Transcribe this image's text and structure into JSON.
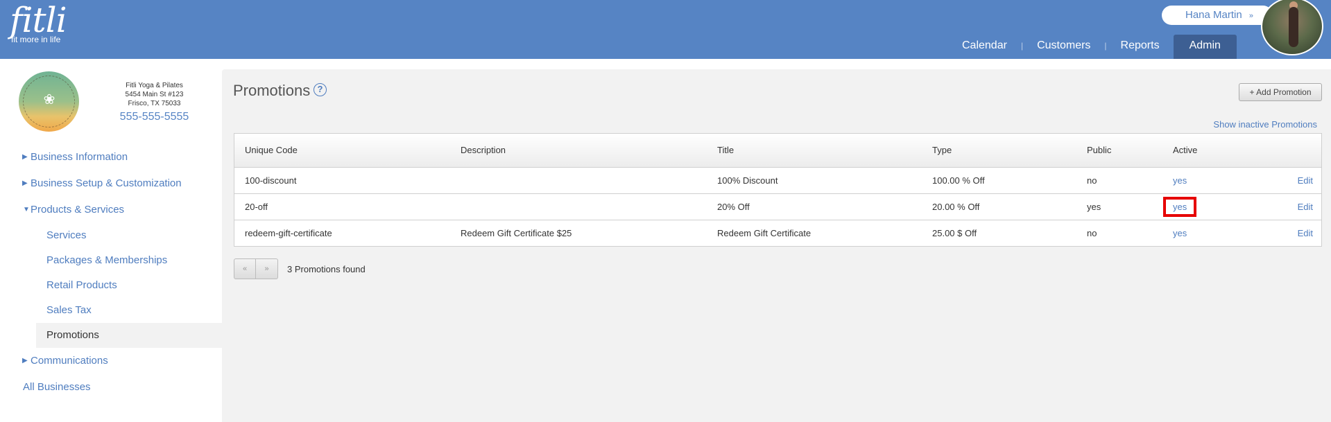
{
  "header": {
    "logo_word": "fitli",
    "logo_tagline": "fit more in life",
    "user_name": "Hana Martin",
    "user_chevron": "»",
    "nav": [
      {
        "label": "Calendar",
        "active": false
      },
      {
        "label": "Customers",
        "active": false
      },
      {
        "label": "Reports",
        "active": false
      },
      {
        "label": "Admin",
        "active": true
      }
    ]
  },
  "business": {
    "name": "Fitli Yoga & Pilates",
    "address1": "5454 Main St #123",
    "address2": "Frisco, TX 75033",
    "phone": "555-555-5555",
    "logo_icon": "lotus-meditation-icon"
  },
  "sidebar": {
    "items": [
      {
        "label": "Business Information",
        "expanded": false
      },
      {
        "label": "Business Setup & Customization",
        "expanded": false
      },
      {
        "label": "Products & Services",
        "expanded": true
      }
    ],
    "sub_items": [
      {
        "label": "Services"
      },
      {
        "label": "Packages & Memberships"
      },
      {
        "label": "Retail Products"
      },
      {
        "label": "Sales Tax"
      },
      {
        "label": "Promotions",
        "active": true
      }
    ],
    "communications": "Communications",
    "all_businesses": "All Businesses"
  },
  "main": {
    "title": "Promotions",
    "help_glyph": "?",
    "add_button": "+ Add Promotion",
    "show_inactive": "Show inactive Promotions",
    "table": {
      "headers": [
        "Unique Code",
        "Description",
        "Title",
        "Type",
        "Public",
        "Active",
        ""
      ],
      "rows": [
        {
          "code": "100-discount",
          "description": "",
          "title": "100% Discount",
          "type": "100.00 % Off",
          "public": "no",
          "active": "yes",
          "edit": "Edit"
        },
        {
          "code": "20-off",
          "description": "",
          "title": "20% Off",
          "type": "20.00 % Off",
          "public": "yes",
          "active": "yes",
          "edit": "Edit"
        },
        {
          "code": "redeem-gift-certificate",
          "description": "Redeem Gift Certificate $25",
          "title": "Redeem Gift Certificate",
          "type": "25.00 $ Off",
          "public": "no",
          "active": "yes",
          "edit": "Edit"
        }
      ]
    },
    "pager": {
      "prev": "«",
      "next": "»",
      "info": "3 Promotions found"
    }
  },
  "colors": {
    "header_bg": "#5684c4",
    "active_tab": "#3d5f93",
    "link": "#4f7dbf",
    "highlight": "#e60000"
  }
}
